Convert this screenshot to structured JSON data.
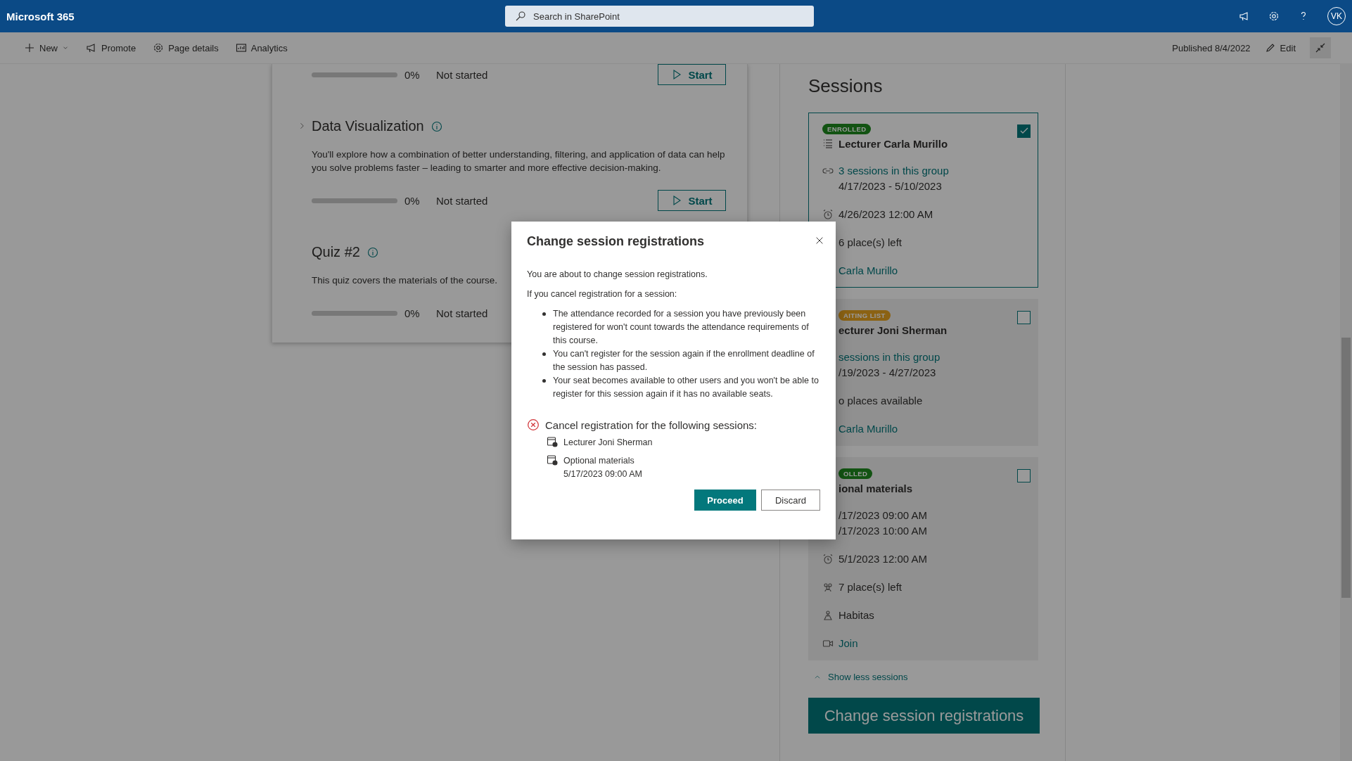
{
  "topbar": {
    "app_name": "Microsoft 365",
    "search": {
      "placeholder": "Search in SharePoint"
    },
    "avatar": "VK"
  },
  "command_bar": {
    "items": [
      {
        "label": "New",
        "dropdown": true
      },
      {
        "label": "Promote",
        "dropdown": false
      },
      {
        "label": "Page details",
        "dropdown": false
      },
      {
        "label": "Analytics",
        "dropdown": false
      }
    ],
    "status": "Published 8/4/2022",
    "edit": "Edit"
  },
  "modules": [
    {
      "level": 0,
      "percent": "0%",
      "status": "Not started",
      "action": "Start"
    },
    {
      "title": "Data Visualization",
      "expandable": true,
      "description": "You'll explore how a combination of better understanding, filtering, and application of data can help you solve problems faster – leading to smarter and more effective decision-making.",
      "level": 0,
      "percent": "0%",
      "status": "Not started",
      "action": "Start"
    },
    {
      "title": "Quiz #2",
      "expandable": false,
      "description": "This quiz covers the materials of the course.",
      "level": 0,
      "percent": "0%",
      "status": "Not started"
    }
  ],
  "sessions": {
    "title": "Sessions",
    "cards": [
      {
        "badge": {
          "text": "ENROLLED",
          "kind": "enrolled"
        },
        "title": "Lecturer Carla Murillo",
        "kind": "group",
        "selected": true,
        "rows": [
          {
            "kind": "group",
            "link": true,
            "text": "3 sessions in this group",
            "lines": [
              "4/17/2023 - 5/10/2023"
            ]
          },
          {
            "kind": "deadline",
            "link": false,
            "text": "4/26/2023 12:00 AM"
          },
          {
            "link": false,
            "text": "6 place(s) left"
          },
          {
            "link": true,
            "text": "Carla Murillo"
          }
        ]
      },
      {
        "badge": {
          "text": "AITING LIST",
          "kind": "waiting"
        },
        "title": "ecturer Joni Sherman",
        "selected": false,
        "rows": [
          {
            "link": true,
            "text": "sessions in this group",
            "lines": [
              "/19/2023 - 4/27/2023"
            ]
          },
          {
            "link": false,
            "text": "o places available"
          },
          {
            "link": true,
            "text": "Carla Murillo"
          }
        ]
      },
      {
        "badge": {
          "text": "OLLED",
          "kind": "enrolled"
        },
        "title": "ional materials",
        "selected": false,
        "rows": [
          {
            "link": false,
            "text": "/17/2023 09:00 AM",
            "lines": [
              "/17/2023 10:00 AM"
            ]
          },
          {
            "kind": "deadline",
            "link": false,
            "text": "5/1/2023 12:00 AM"
          },
          {
            "kind": "seats",
            "link": false,
            "text": "7 place(s) left"
          },
          {
            "kind": "location",
            "link": false,
            "text": "Habitas"
          },
          {
            "kind": "online",
            "link": true,
            "text": "Join"
          }
        ]
      }
    ],
    "toggle": "Show less sessions",
    "submit": "Change session registrations"
  },
  "dialog": {
    "title": "Change session registrations",
    "intro": "You are about to change session registrations.",
    "lead": "If you cancel registration for a session:",
    "bullets": [
      "The attendance recorded for a session you have previously been registered for won't count towards the attendance requirements of this course.",
      "You can't register for the session again if the enrollment deadline of the session has passed.",
      "Your seat becomes available to other users and you won't be able to register for this session again if it has no available seats."
    ],
    "cancel_heading": "Cancel registration for the following sessions:",
    "cancel_items": [
      {
        "title": "Lecturer Joni Sherman"
      },
      {
        "title": "Optional materials",
        "date": "5/17/2023 09:00 AM"
      }
    ],
    "primary": "Proceed",
    "secondary": "Discard"
  }
}
